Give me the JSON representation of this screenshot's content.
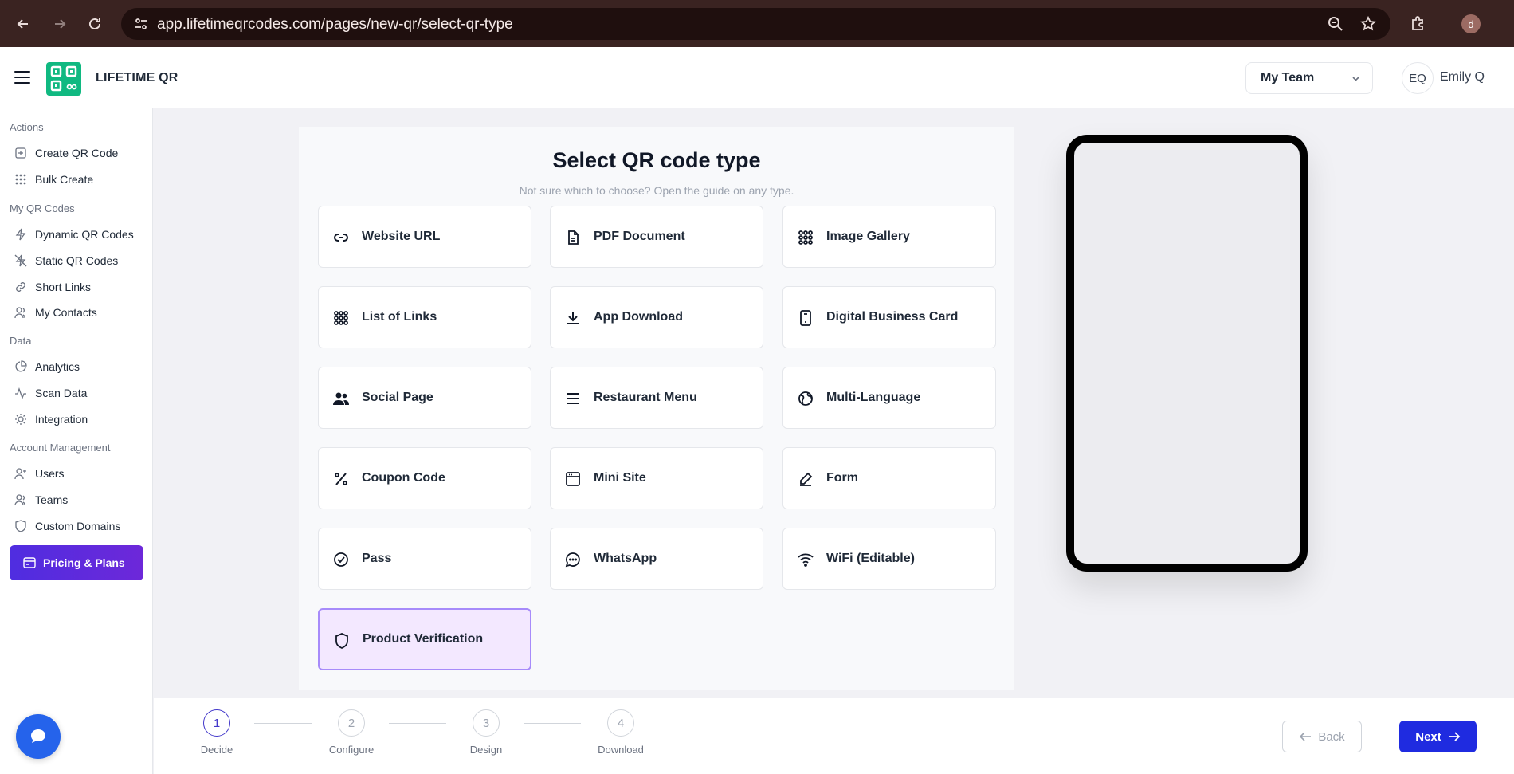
{
  "browser": {
    "url": "app.lifetimeqrcodes.com/pages/new-qr/select-qr-type",
    "profile_initial": "d"
  },
  "header": {
    "brand": "LIFETIME QR",
    "team": "My Team",
    "user_initials": "EQ",
    "user_name": "Emily Q"
  },
  "sidebar": {
    "sections": [
      "Actions",
      "My QR Codes",
      "Data",
      "Account Management"
    ],
    "items": [
      {
        "label": "Create QR Code",
        "icon": "plus-square-icon"
      },
      {
        "label": "Bulk Create",
        "icon": "grid-icon"
      },
      {
        "label": "Dynamic QR Codes",
        "icon": "bolt-icon"
      },
      {
        "label": "Static QR Codes",
        "icon": "bolt-off-icon"
      },
      {
        "label": "Short Links",
        "icon": "link-icon"
      },
      {
        "label": "My Contacts",
        "icon": "contacts-icon"
      },
      {
        "label": "Analytics",
        "icon": "pie-chart-icon"
      },
      {
        "label": "Scan Data",
        "icon": "activity-icon"
      },
      {
        "label": "Integration",
        "icon": "plug-icon"
      },
      {
        "label": "Users",
        "icon": "user-plus-icon"
      },
      {
        "label": "Teams",
        "icon": "users-icon"
      },
      {
        "label": "Custom Domains",
        "icon": "shield-icon"
      }
    ],
    "pricing_label": "Pricing & Plans"
  },
  "main": {
    "title": "Select QR code type",
    "subtitle": "Not sure which to choose? Open the guide on any type.",
    "types": [
      {
        "label": "Website URL",
        "icon": "link-icon"
      },
      {
        "label": "PDF Document",
        "icon": "file-icon"
      },
      {
        "label": "Image Gallery",
        "icon": "grid-dots-icon"
      },
      {
        "label": "List of Links",
        "icon": "grid-dots-icon"
      },
      {
        "label": "App Download",
        "icon": "download-icon"
      },
      {
        "label": "Digital Business Card",
        "icon": "phone-card-icon"
      },
      {
        "label": "Social Page",
        "icon": "people-icon"
      },
      {
        "label": "Restaurant Menu",
        "icon": "menu-lines-icon"
      },
      {
        "label": "Multi-Language",
        "icon": "globe-icon"
      },
      {
        "label": "Coupon Code",
        "icon": "percent-icon"
      },
      {
        "label": "Mini Site",
        "icon": "browser-icon"
      },
      {
        "label": "Form",
        "icon": "pen-icon"
      },
      {
        "label": "Pass",
        "icon": "check-circle-icon"
      },
      {
        "label": "WhatsApp",
        "icon": "chat-icon"
      },
      {
        "label": "WiFi (Editable)",
        "icon": "wifi-icon"
      },
      {
        "label": "Product Verification",
        "icon": "shield-icon",
        "selected": true
      }
    ]
  },
  "stepper": {
    "steps": [
      {
        "number": "1",
        "label": "Decide",
        "active": true
      },
      {
        "number": "2",
        "label": "Configure",
        "active": false
      },
      {
        "number": "3",
        "label": "Design",
        "active": false
      },
      {
        "number": "4",
        "label": "Download",
        "active": false
      }
    ],
    "back_label": "Back",
    "next_label": "Next"
  },
  "colors": {
    "accent": "#1f2be0",
    "selected_card_bg": "#f3e8ff",
    "selected_card_border": "#a78bfa",
    "logo_green": "#10b981"
  }
}
